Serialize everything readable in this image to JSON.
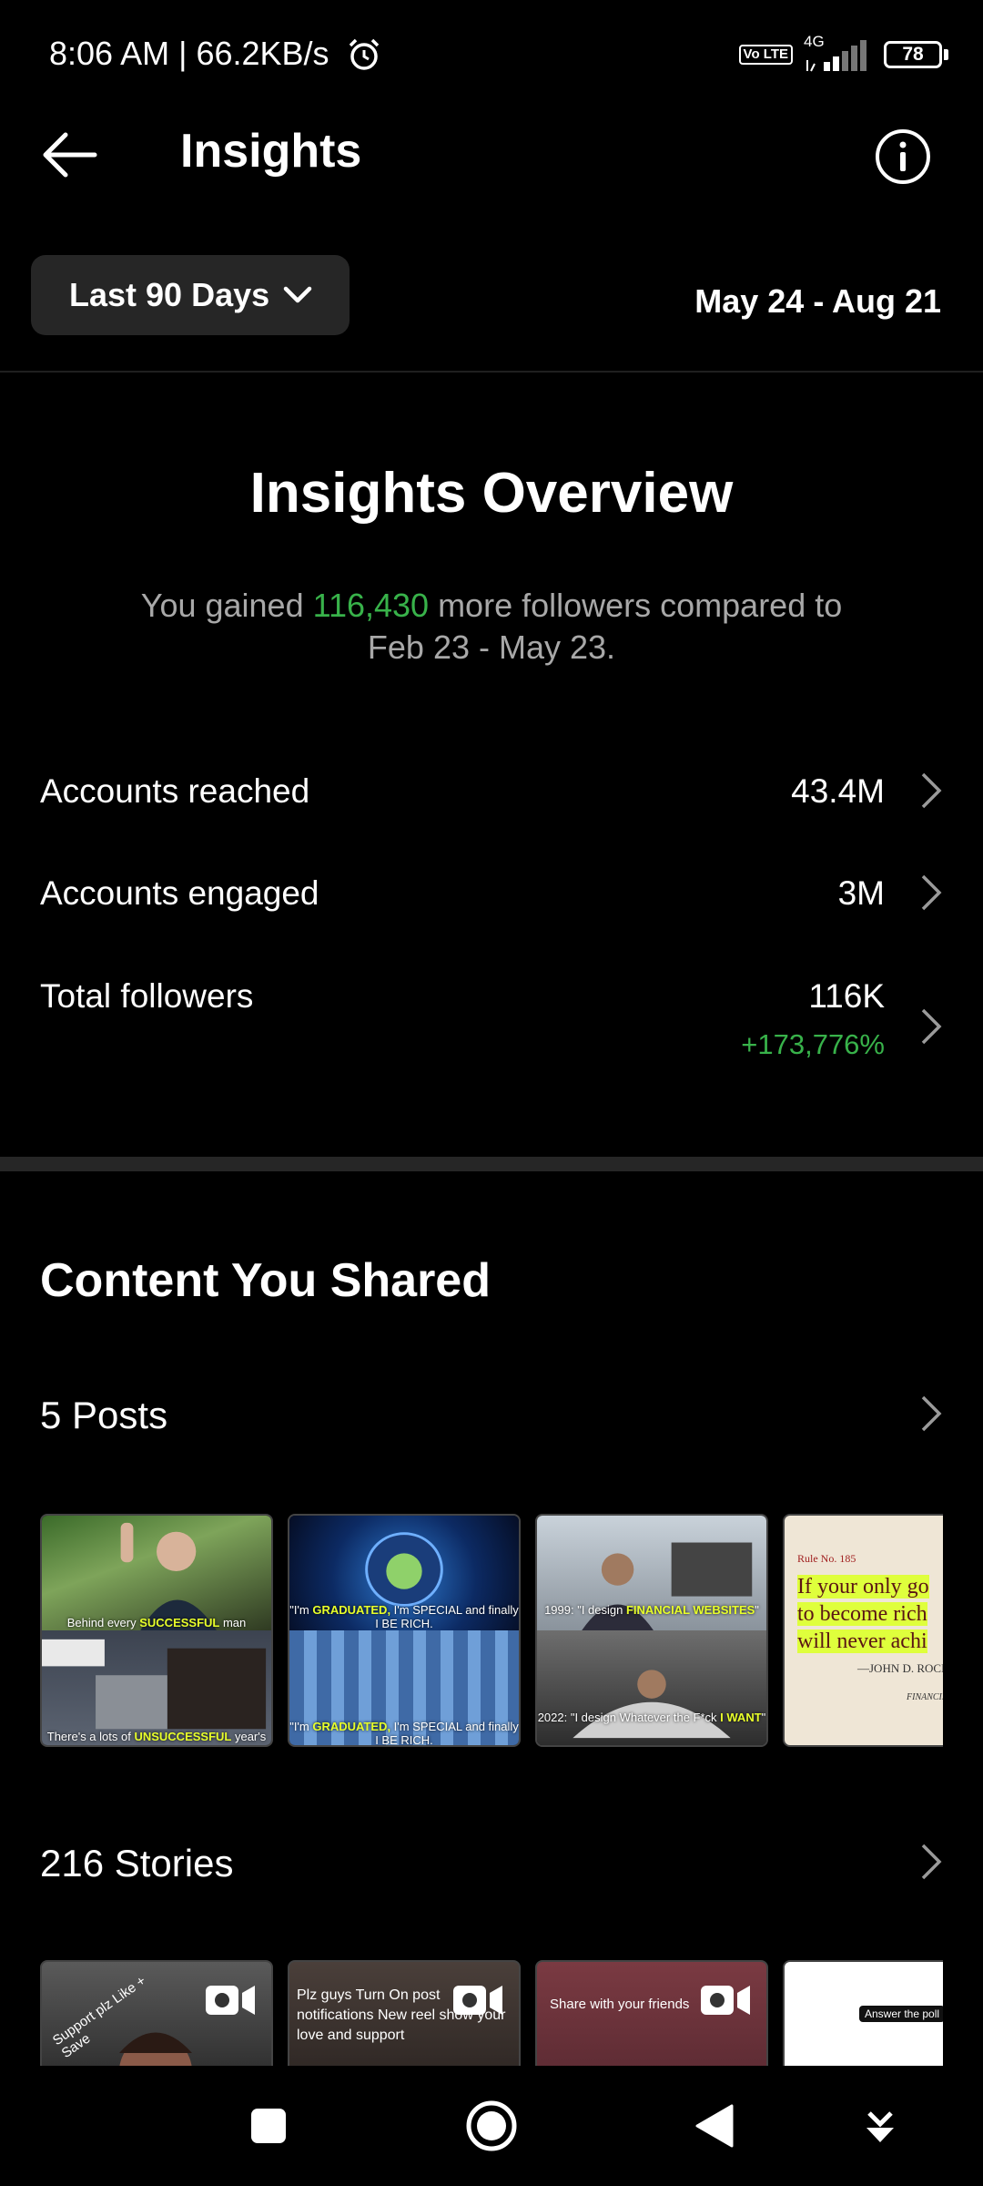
{
  "status_bar": {
    "time": "8:06 AM | 66.2KB/s",
    "volte": "Vo LTE",
    "network": "4G",
    "battery": "78"
  },
  "header": {
    "title": "Insights"
  },
  "filter": {
    "period": "Last 90 Days",
    "date_range": "May 24 - Aug 21"
  },
  "overview": {
    "title": "Insights Overview",
    "summary_prefix": "You gained ",
    "gained": "116,430",
    "summary_suffix": " more followers compared to Feb 23 - May 23."
  },
  "metrics": [
    {
      "label": "Accounts reached",
      "value": "43.4M"
    },
    {
      "label": "Accounts engaged",
      "value": "3M"
    },
    {
      "label": "Total followers",
      "value": "116K",
      "change": "+173,776%"
    }
  ],
  "content": {
    "title": "Content You Shared",
    "posts_label": "5 Posts",
    "stories_label": "216 Stories"
  },
  "posts": [
    {
      "top_caption_pre": "Behind every ",
      "top_caption_hl": "SUCCESSFUL",
      "top_caption_post": " man",
      "bottom_caption_pre": "There's a lots of ",
      "bottom_caption_hl": "UNSUCCESSFUL",
      "bottom_caption_post": " year's"
    },
    {
      "top_caption_pre": "\"I'm ",
      "top_caption_hl": "GRADUATED,",
      "top_caption_post": " I'm SPECIAL and finally I BE RICH.",
      "bottom_caption_pre": "\"I'm ",
      "bottom_caption_hl": "GRADUATED,",
      "bottom_caption_post": " I'm SPECIAL and finally I BE RICH."
    },
    {
      "top_caption_pre": "1999: \"I design ",
      "top_caption_hl": "FINANCIAL WEBSITES",
      "top_caption_post": "\"",
      "bottom_caption_pre": "2022: \"I design Whatever the F*ck ",
      "bottom_caption_hl": "I WANT",
      "bottom_caption_post": "\""
    },
    {
      "rule": "Rule No. 185",
      "quote_1": "If your only go",
      "quote_2": "to become rich",
      "quote_3": "will never achi",
      "author": "—JOHN D. ROCKEFELL",
      "role": "FINANCIER"
    }
  ],
  "stories": [
    {
      "text": "Support plz Like + Save"
    },
    {
      "text": "Plz guys Turn On post notifications New reel show your love and support"
    },
    {
      "text": "Share with your friends"
    },
    {
      "text": "Answer the poll"
    }
  ],
  "colors": {
    "accent_green": "#38b24a",
    "button_bg": "#262626",
    "highlight_yellow": "#e8ff2a"
  }
}
